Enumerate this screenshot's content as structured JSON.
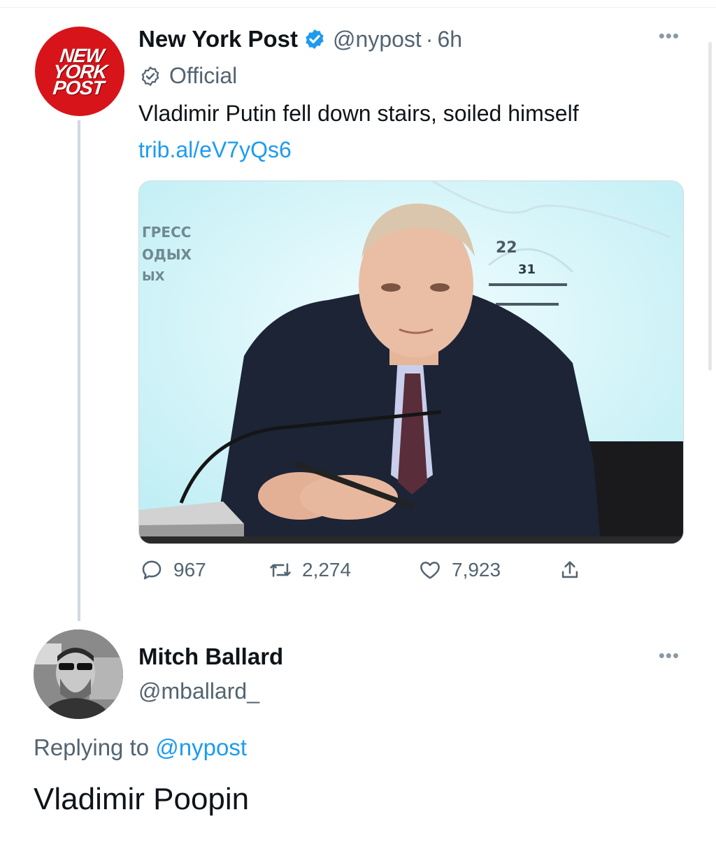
{
  "tweet": {
    "logo_lines": [
      "NEW",
      "YORK",
      "POST"
    ],
    "name": "New York Post",
    "handle": "@nypost",
    "separator": "·",
    "time": "6h",
    "label": "Official",
    "text": "Vladimir Putin fell down stairs, soiled himself",
    "link": "trib.al/eV7yQs6",
    "media_text": [
      "ГРЕСС",
      "ОДЫХ",
      "ЫХ",
      "22",
      "31"
    ],
    "replies": "967",
    "retweets": "2,274",
    "likes": "7,923",
    "icons": {
      "more": "more-icon",
      "verified": "verified-badge-icon",
      "official": "official-badge-icon",
      "reply": "reply-icon",
      "retweet": "retweet-icon",
      "like": "heart-icon",
      "share": "share-icon"
    }
  },
  "reply": {
    "name": "Mitch Ballard",
    "handle": "@mballard_",
    "replying_prefix": "Replying to",
    "replying_to": "@nypost",
    "text": "Vladimir Poopin"
  },
  "colors": {
    "link_blue": "#1d9bf0",
    "muted_gray": "#536471",
    "nypost_red": "#d7141a",
    "text_dark": "#0f1419"
  }
}
